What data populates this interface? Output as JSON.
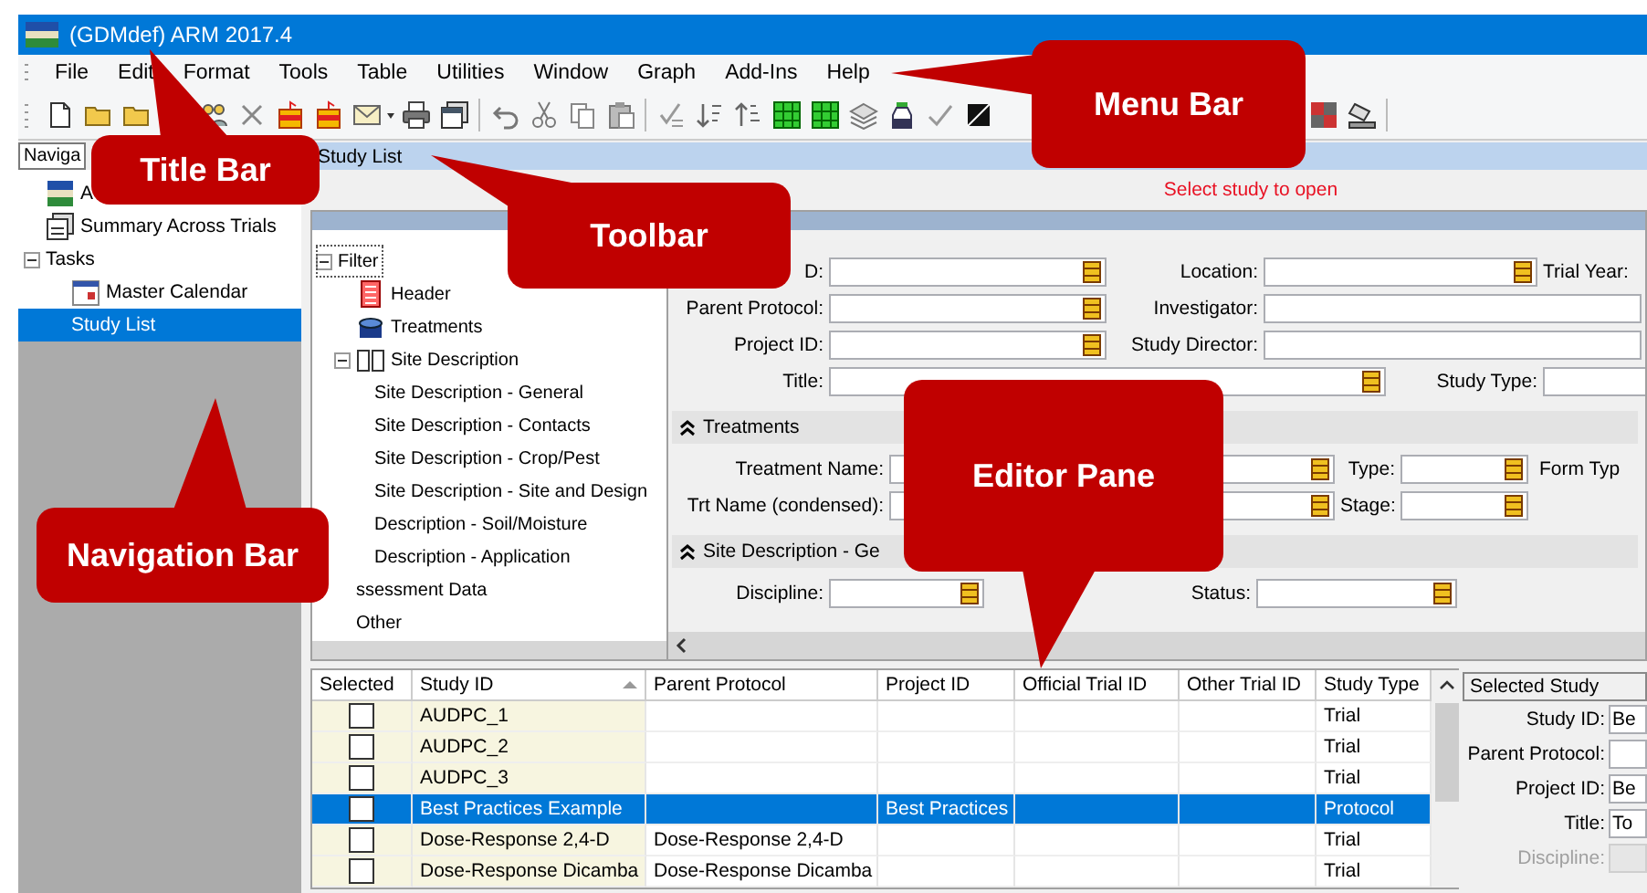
{
  "window": {
    "title": "(GDMdef) ARM 2017.4"
  },
  "menu_bar": [
    "File",
    "Edit",
    "Format",
    "Tools",
    "Table",
    "Utilities",
    "Window",
    "Graph",
    "Add-Ins",
    "Help"
  ],
  "navigation": {
    "selector": "Naviga",
    "items": [
      {
        "label": "A",
        "kind": "logo",
        "selected": false
      },
      {
        "label": "Summary Across Trials",
        "kind": "report",
        "selected": false
      },
      {
        "label": "Tasks",
        "selected": false,
        "expanded": true,
        "children": [
          {
            "label": "Master Calendar",
            "kind": "calendar",
            "selected": false
          },
          {
            "label": "Study List",
            "selected": true
          }
        ]
      }
    ]
  },
  "study_list": {
    "title": "Study List",
    "message": "Select study to open"
  },
  "filter_tree": {
    "items": [
      {
        "label": "Filter",
        "selected": true,
        "expanded": true,
        "children": [
          {
            "label": "Header",
            "kind": "header",
            "selected": false
          },
          {
            "label": "Treatments",
            "kind": "treatments",
            "selected": false
          },
          {
            "label": "Site Description",
            "kind": "book",
            "selected": false,
            "expanded": true,
            "children": [
              {
                "label": "Site Description - General",
                "selected": false
              },
              {
                "label": "Site Description - Contacts",
                "selected": false
              },
              {
                "label": "Site Description - Crop/Pest",
                "selected": false
              },
              {
                "label": "Site Description - Site and Design",
                "selected": false
              },
              {
                "label": "Description - Soil/Moisture",
                "selected": false
              },
              {
                "label": "Description - Application",
                "selected": false
              }
            ]
          },
          {
            "label": "ssessment Data",
            "selected": false
          },
          {
            "label": "Other",
            "selected": false
          }
        ]
      }
    ]
  },
  "form": {
    "sections": [
      {
        "rows": [
          [
            {
              "label": "D:",
              "kind": "normal",
              "lookup": true
            },
            {
              "label": "Location:",
              "kind": "normal",
              "lookup": true
            },
            {
              "label": "Trial Year:",
              "kind": "label_only"
            }
          ],
          [
            {
              "label": "Parent Protocol:",
              "kind": "normal",
              "lookup": true
            },
            {
              "label": "Investigator:",
              "kind": "wide",
              "lookup": false
            }
          ],
          [
            {
              "label": "Project ID:",
              "kind": "normal",
              "lookup": true
            },
            {
              "label": "Study Director:",
              "kind": "wide",
              "lookup": false
            }
          ],
          [
            {
              "label": "Title:",
              "kind": "long",
              "lookup": true
            },
            {
              "label": "Study Type:",
              "kind": "normal",
              "lookup": false
            }
          ]
        ]
      },
      {
        "title": "Treatments",
        "expanded": true,
        "rows": [
          [
            {
              "label": "Treatment Name:",
              "kind": "normal",
              "lookup": true
            },
            {
              "label": "Type:",
              "kind": "normal",
              "lookup": true
            },
            {
              "label": "Form Typ",
              "kind": "label_only"
            }
          ],
          [
            {
              "label": "Trt Name (condensed):",
              "kind": "normal",
              "lookup": true
            },
            {
              "label": "Stage:",
              "kind": "normal",
              "lookup": true
            }
          ]
        ]
      },
      {
        "title": "Site Description - Ge",
        "expanded": true,
        "rows": [
          [
            {
              "label": "Discipline:",
              "kind": "normal",
              "lookup": true
            },
            {
              "label": "Status:",
              "kind": "normal",
              "lookup": true
            }
          ]
        ]
      }
    ]
  },
  "table": {
    "columns": [
      {
        "label": "Selected",
        "sorted": false
      },
      {
        "label": "Study ID",
        "sorted": true
      },
      {
        "label": "Parent Protocol",
        "sorted": false
      },
      {
        "label": "Project ID",
        "sorted": false
      },
      {
        "label": "Official Trial ID",
        "sorted": false
      },
      {
        "label": "Other Trial ID",
        "sorted": false
      },
      {
        "label": "Study Type",
        "sorted": false
      }
    ],
    "rows": [
      {
        "checked": false,
        "selected": false,
        "study_id": "AUDPC_1",
        "study_type": "Trial"
      },
      {
        "checked": false,
        "selected": false,
        "study_id": "AUDPC_2",
        "study_type": "Trial"
      },
      {
        "checked": false,
        "selected": false,
        "study_id": "AUDPC_3",
        "study_type": "Trial"
      },
      {
        "checked": false,
        "selected": true,
        "study_id": "Best Practices Example",
        "project_id": "Best Practices",
        "study_type": "Protocol"
      },
      {
        "checked": false,
        "selected": false,
        "study_id": "Dose-Response 2,4-D",
        "parent_protocol": "Dose-Response 2,4-D",
        "study_type": "Trial"
      },
      {
        "checked": false,
        "selected": false,
        "study_id": "Dose-Response Dicamba",
        "parent_protocol": "Dose-Response Dicamba",
        "study_type": "Trial"
      }
    ]
  },
  "selected_study": {
    "title": "Selected Study",
    "fields": [
      {
        "label": "Study ID:",
        "value": "Be",
        "disabled": false
      },
      {
        "label": "Parent Protocol:",
        "disabled": false
      },
      {
        "label": "Project ID:",
        "value": "Be",
        "disabled": false
      },
      {
        "label": "Title:",
        "value": "To",
        "disabled": false
      },
      {
        "label": "Discipline:",
        "disabled": true
      }
    ]
  },
  "callouts": [
    {
      "label": "Menu Bar"
    },
    {
      "label": "Title Bar"
    },
    {
      "label": "Toolbar"
    },
    {
      "label": "Editor Pane"
    },
    {
      "label": "Navigation Bar"
    }
  ]
}
